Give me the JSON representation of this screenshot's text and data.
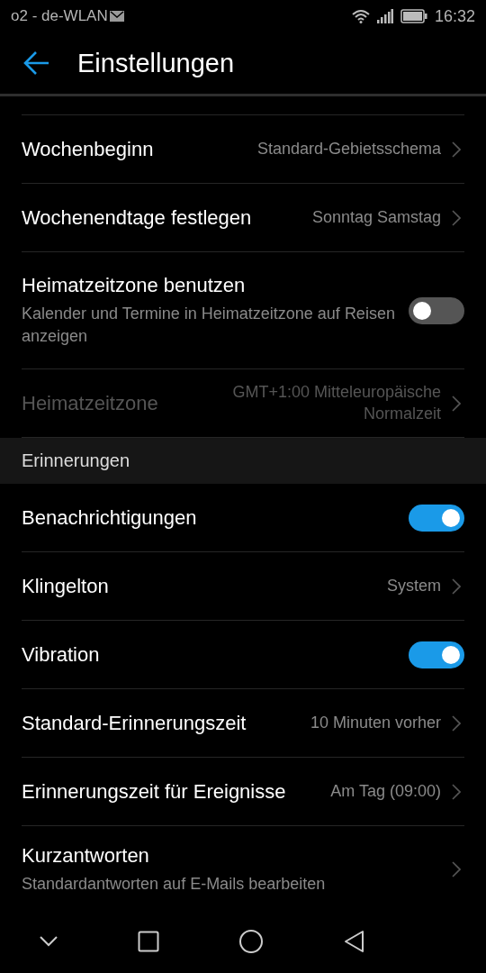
{
  "status_bar": {
    "carrier": "o2 - de-WLAN",
    "time": "16:32"
  },
  "app_bar": {
    "title": "Einstellungen"
  },
  "sections": [
    {
      "rows": [
        {
          "kind": "link",
          "title": "Wochenbeginn",
          "value": "Standard-Gebietsschema",
          "disabled": false
        },
        {
          "kind": "link",
          "title": "Wochenendtage festlegen",
          "value": "Sonntag Samstag",
          "disabled": false
        },
        {
          "kind": "toggle",
          "title": "Heimatzeitzone benutzen",
          "subtitle": "Kalender und Termine in Heimatzeitzone auf Reisen anzeigen",
          "on": false,
          "disabled": false
        },
        {
          "kind": "link",
          "title": "Heimatzeitzone",
          "value": "GMT+1:00 Mitteleuropäische Normalzeit",
          "disabled": true
        }
      ]
    },
    {
      "header": "Erinnerungen",
      "rows": [
        {
          "kind": "toggle",
          "title": "Benachrichtigungen",
          "on": true,
          "disabled": false
        },
        {
          "kind": "link",
          "title": "Klingelton",
          "value": "System",
          "disabled": false
        },
        {
          "kind": "toggle",
          "title": "Vibration",
          "on": true,
          "disabled": false
        },
        {
          "kind": "link",
          "title": "Standard-Erinnerungszeit",
          "value": "10 Minuten vorher",
          "disabled": false
        },
        {
          "kind": "link",
          "title": "Erinnerungszeit für Ereignisse",
          "value": "Am Tag (09:00)",
          "disabled": false
        },
        {
          "kind": "link",
          "title": "Kurzantworten",
          "subtitle": "Standardantworten auf E-Mails bearbeiten",
          "disabled": false
        }
      ]
    }
  ]
}
